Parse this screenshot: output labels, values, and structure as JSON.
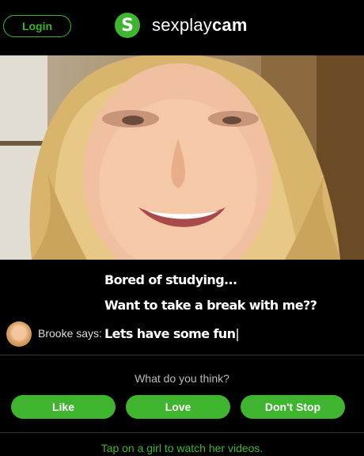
{
  "header": {
    "login_label": "Login",
    "logo_mark": "S",
    "logo_text_light": "sexplay",
    "logo_text_bold": "cam"
  },
  "chat": {
    "line1": "Bored of studying...",
    "line2": "Want to take a break with me??",
    "speaker": "Brooke says:",
    "line3": "Lets have some fun",
    "cursor": "|"
  },
  "poll": {
    "question": "What do you think?",
    "options": [
      "Like",
      "Love",
      "Don't Stop"
    ]
  },
  "footer": {
    "text": "Tap on a girl to watch her videos."
  },
  "colors": {
    "accent": "#3fb52f",
    "background": "#000000"
  }
}
